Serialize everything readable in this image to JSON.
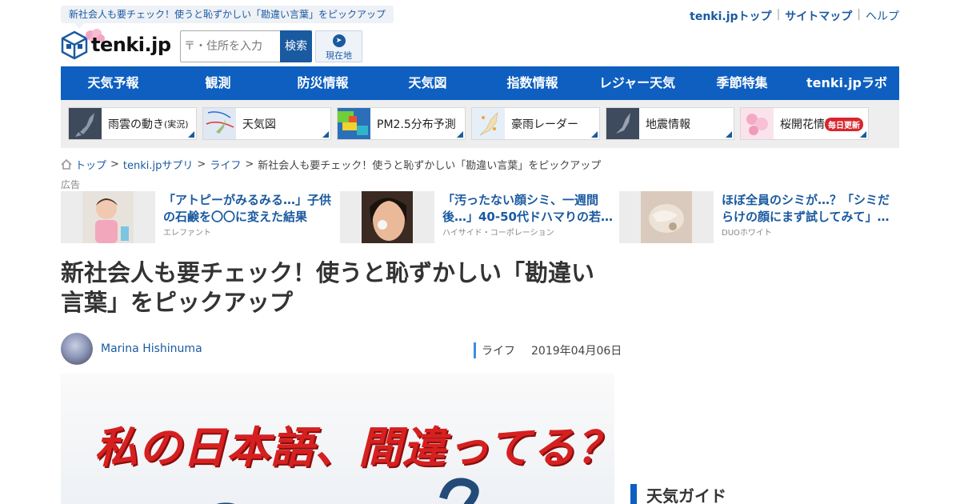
{
  "header": {
    "tagline": "新社会人も要チェック！使うと恥ずかしい「勘違い言葉」をピックアップ",
    "top_links": [
      "tenki.jpトップ",
      "サイトマップ",
      "ヘルプ"
    ],
    "logo_text": "tenki.jp",
    "search_placeholder": "〒・住所を入力",
    "search_button": "検索",
    "location_button": "現在地"
  },
  "nav": [
    "天気予報",
    "観測",
    "防災情報",
    "天気図",
    "指数情報",
    "レジャー天気",
    "季節特集",
    "tenki.jpラボ"
  ],
  "quick_links": [
    {
      "label": "雨雲の動き",
      "sub": "(実況)",
      "icon": "rain-map-thumb"
    },
    {
      "label": "天気図",
      "sub": "",
      "icon": "weather-map-thumb"
    },
    {
      "label": "PM2.5分布予測",
      "sub": "",
      "icon": "pm25-map-thumb"
    },
    {
      "label": "豪雨レーダー",
      "sub": "",
      "icon": "radar-map-thumb"
    },
    {
      "label": "地震情報",
      "sub": "",
      "icon": "earthquake-map-thumb"
    },
    {
      "label": "桜開花情報",
      "sub": "",
      "icon": "sakura-thumb",
      "badge": "毎日更新"
    }
  ],
  "breadcrumb": [
    "トップ",
    "tenki.jpサプリ",
    "ライフ",
    "新社会人も要チェック！使うと恥ずかしい「勘違い言葉」をピックアップ"
  ],
  "ad_label": "広告",
  "ads": [
    {
      "title": "「アトピーがみるみる…」子供の石鹸を〇〇に変えた結果",
      "sponsor": "エレファント"
    },
    {
      "title": "「汚ったない顔シミ、一週間後…」40-50代ドハマりの若…",
      "sponsor": "ハイサイド・コーポレーション"
    },
    {
      "title": "ほぼ全員のシミが…？「シミだらけの顔にまず試してみて」…",
      "sponsor": "DUOホワイト"
    }
  ],
  "article": {
    "title": "新社会人も要チェック！使うと恥ずかしい「勘違い言葉」をピックアップ",
    "author": "Marina Hishinuma",
    "category": "ライフ",
    "date": "2019年04月06日",
    "hero_text": "私の日本語、間違ってる？"
  },
  "sidebar": {
    "title": "天気ガイド"
  },
  "colors": {
    "brand": "#0e5fc0",
    "link": "#1a5aa0",
    "badge": "#d7262e"
  }
}
